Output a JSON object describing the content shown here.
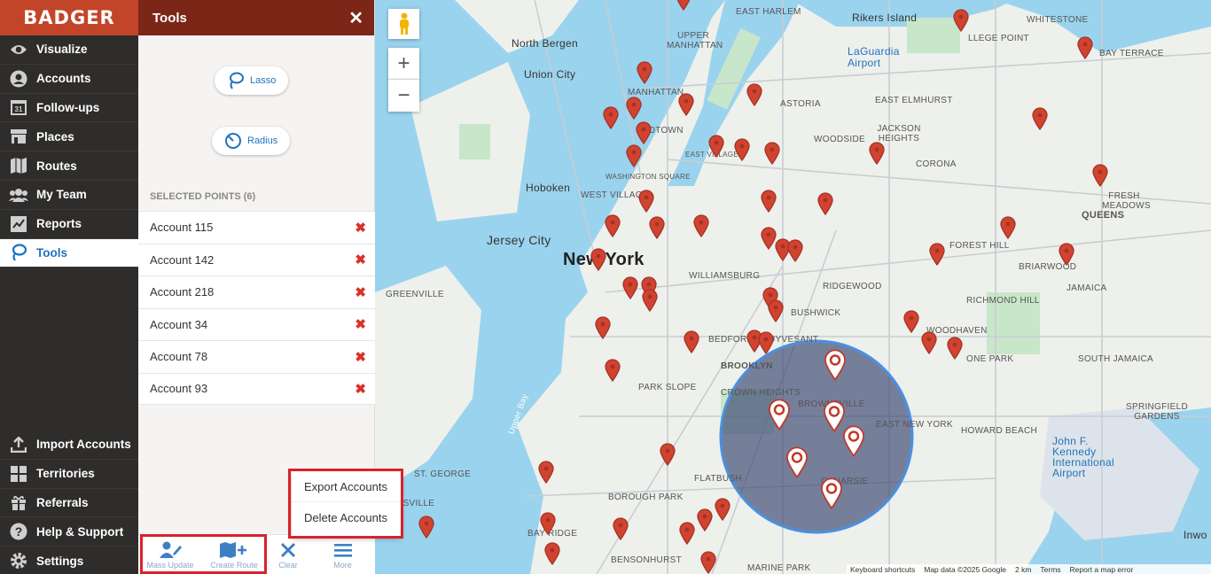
{
  "app": {
    "brand": "BADGER"
  },
  "nav": {
    "items": [
      {
        "label": "Visualize",
        "icon": "eye-icon"
      },
      {
        "label": "Accounts",
        "icon": "user-circle-icon"
      },
      {
        "label": "Follow-ups",
        "icon": "calendar-icon",
        "icon_text": "31"
      },
      {
        "label": "Places",
        "icon": "store-icon"
      },
      {
        "label": "Routes",
        "icon": "map-icon"
      },
      {
        "label": "My Team",
        "icon": "team-icon"
      },
      {
        "label": "Reports",
        "icon": "report-icon"
      },
      {
        "label": "Tools",
        "icon": "lasso-icon",
        "active": true
      }
    ],
    "bottom_items": [
      {
        "label": "Import Accounts",
        "icon": "upload-icon"
      },
      {
        "label": "Territories",
        "icon": "territories-icon"
      },
      {
        "label": "Referrals",
        "icon": "gift-icon"
      },
      {
        "label": "Help & Support",
        "icon": "help-icon"
      },
      {
        "label": "Settings",
        "icon": "gear-icon"
      }
    ]
  },
  "panel": {
    "title": "Tools",
    "lasso_label": "Lasso",
    "radius_label": "Radius",
    "selected_title": "SELECTED POINTS (6)",
    "selected": [
      "Account 115",
      "Account 142",
      "Account 218",
      "Account 34",
      "Account 78",
      "Account 93"
    ],
    "bottom_bar": {
      "mass_update": "Mass Update",
      "create_route": "Create Route",
      "clear": "Clear",
      "more": "More"
    },
    "more_menu": {
      "export": "Export Accounts",
      "delete": "Delete Accounts"
    }
  },
  "map": {
    "labels": {
      "new_york": "New York",
      "jersey_city": "Jersey City",
      "hoboken": "Hoboken",
      "union_city": "Union City",
      "north_bergen": "North Bergen",
      "queens": "QUEENS",
      "rikers": "Rikers Island",
      "laguardia": "LaGuardia Airport",
      "jfk": "John F. Kennedy International Airport",
      "brooklyn": "BROOKLYN",
      "williamsburg": "WILLIAMSBURG",
      "bushwick": "BUSHWICK",
      "ridgewood": "RIDGEWOOD",
      "crown_heights": "CROWN HEIGHTS",
      "brownsville": "BROWNSVILLE",
      "canarsie": "CANARSIE",
      "flatbush": "FLATBUSH",
      "park_slope": "PARK SLOPE",
      "borough_park": "BOROUGH PARK",
      "bensonhurst": "BENSONHURST",
      "bay_ridge": "BAY RIDGE",
      "woodside": "WOODSIDE",
      "corona": "CORONA",
      "jamaica": "JAMAICA",
      "greenville": "GREENVILLE",
      "manhattan": "MANHATTAN",
      "midtown": "MIDTOWN",
      "west_village": "WEST VILLAGE",
      "east_new_york": "EAST NEW YORK",
      "woodhaven": "WOODHAVEN",
      "richmond_hill": "RICHMOND HILL",
      "forest_hill": "FOREST HILL",
      "howard_beach": "HOWARD BEACH",
      "south_jamaica": "SOUTH JAMAICA",
      "st_george": "ST. GEORGE",
      "kinsville": "KINSVILLE",
      "marine_park": "MARINE PARK",
      "upper_bay": "Upper Bay",
      "bedford": "BEDFORD-STUYVESANT",
      "upper_manhattan": "UPPER MANHATTAN",
      "east_harlem": "EAST HARLEM",
      "astoria": "ASTORIA",
      "jackson_heights": "JACKSON HEIGHTS",
      "east_elmhurst": "EAST ELMHURST",
      "fresh_meadows": "FRESH MEADOWS",
      "bay_terrace": "BAY TERRACE",
      "college_point": "LLEGE POINT",
      "whitestone": "WHITESTONE",
      "briarwood": "BRIARWOOD",
      "springfield": "SPRINGFIELD GARDENS",
      "ozone_park": "ONE PARK",
      "east_village": "EAST VILLAGE",
      "washington_sq": "WASHINGTON SQUARE",
      "inwood": "Inwo"
    },
    "footer": [
      "Keyboard shortcuts",
      "Map data ©2025 Google",
      "2 km",
      "Terms",
      "Report a map error"
    ]
  }
}
